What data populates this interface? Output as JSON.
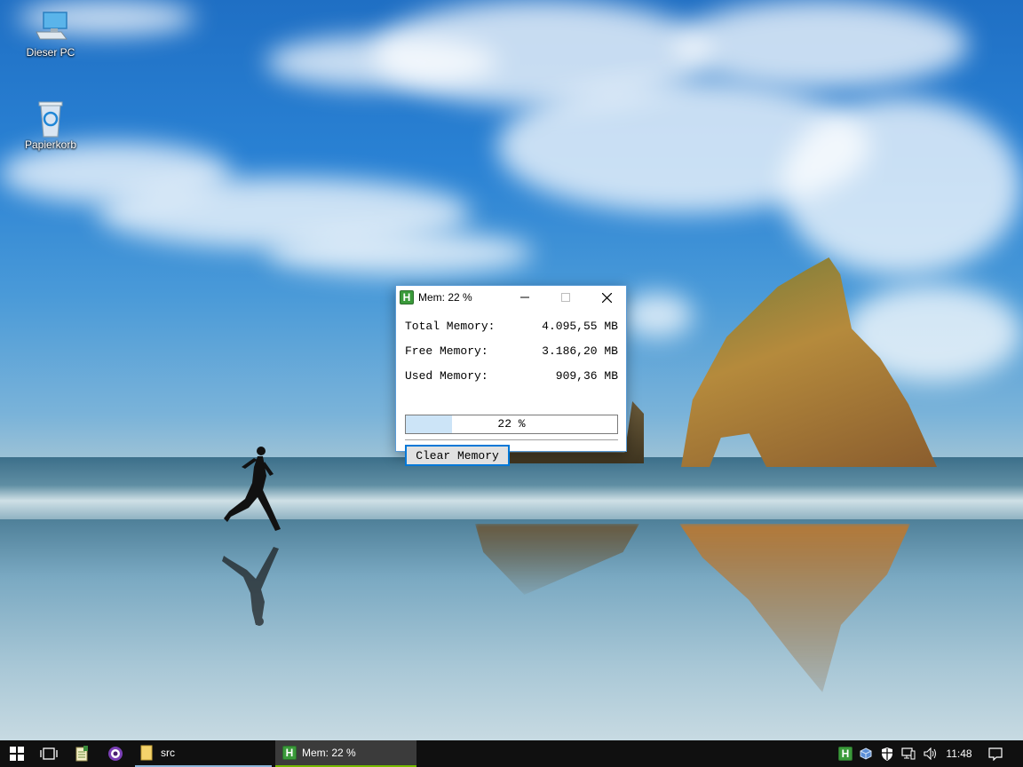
{
  "desktop": {
    "icons": [
      {
        "label": "Dieser PC",
        "icon": "computer-icon"
      },
      {
        "label": "Papierkorb",
        "icon": "recycle-bin-icon"
      }
    ]
  },
  "window": {
    "title": "Mem: 22 %",
    "icon_glyph": "H",
    "rows": [
      {
        "label": "Total Memory:",
        "value": "4.095,55 MB"
      },
      {
        "label": "Free Memory:",
        "value": "3.186,20 MB"
      },
      {
        "label": "Used Memory:",
        "value": "909,36 MB"
      }
    ],
    "progress": {
      "percent": 22,
      "text": "22 %"
    },
    "clear_button": "Clear Memory"
  },
  "taskbar": {
    "folder_task_label": "src",
    "app_task_label": "Mem: 22 %",
    "app_task_glyph": "H",
    "clock": "11:48",
    "accent_color": "#3a9a3a"
  }
}
